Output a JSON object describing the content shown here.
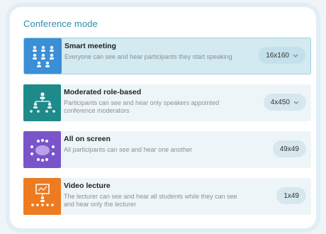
{
  "panel": {
    "title": "Conference mode"
  },
  "modes": [
    {
      "name": "Smart meeting",
      "description": "Everyone can see and hear participants they start speaking",
      "value": "16x160",
      "has_dropdown": true,
      "selected": true,
      "icon": "group-grid-icon",
      "color": "#3a8fd6"
    },
    {
      "name": "Moderated role-based",
      "description": "Participants can see and hear only speakers appointed conference moderators",
      "value": "4x450",
      "has_dropdown": true,
      "selected": false,
      "icon": "hierarchy-icon",
      "color": "#1e8a8a"
    },
    {
      "name": "All on screen",
      "description": "All participants can see and hear one another",
      "value": "49x49",
      "has_dropdown": false,
      "selected": false,
      "icon": "round-table-icon",
      "color": "#7a55c9"
    },
    {
      "name": "Video lecture",
      "description": "The lecturer can see and hear all students while they can see and hear only the lecturer",
      "value": "1x49",
      "has_dropdown": false,
      "selected": false,
      "icon": "presenter-board-icon",
      "color": "#ee7b1f"
    }
  ]
}
